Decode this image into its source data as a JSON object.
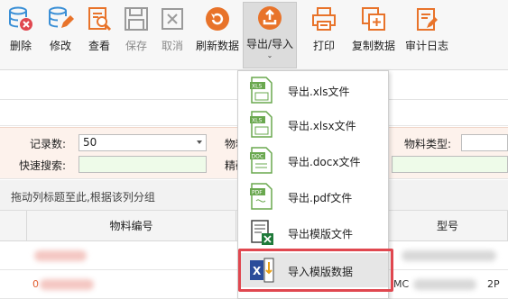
{
  "toolbar": {
    "buttons": [
      {
        "label": "删除",
        "icon": "delete-db-icon",
        "enabled": true
      },
      {
        "label": "修改",
        "icon": "edit-db-icon",
        "enabled": true
      },
      {
        "label": "查看",
        "icon": "view-icon",
        "enabled": true
      },
      {
        "label": "保存",
        "icon": "save-icon",
        "enabled": false
      },
      {
        "label": "取消",
        "icon": "cancel-icon",
        "enabled": false
      },
      {
        "label": "刷新数据",
        "icon": "refresh-icon",
        "enabled": true
      },
      {
        "label": "导出/导入",
        "icon": "export-import-icon",
        "enabled": true,
        "active": true
      },
      {
        "label": "打印",
        "icon": "print-icon",
        "enabled": true
      },
      {
        "label": "复制数据",
        "icon": "copy-icon",
        "enabled": true
      },
      {
        "label": "审计日志",
        "icon": "audit-log-icon",
        "enabled": true
      }
    ],
    "caret": "⌄"
  },
  "filters": {
    "record_count_label": "记录数:",
    "record_count_value": "50",
    "material_label": "物料",
    "material_type_label": "物料类型:",
    "quick_search_label": "快速搜索:",
    "precise_label": "精确"
  },
  "grid": {
    "group_hint": "拖动列标题至此,根据该列分组",
    "columns": [
      "物料编号",
      "型号"
    ],
    "row_fragments": [
      "0",
      "MC",
      "2P"
    ]
  },
  "export_menu": {
    "items": [
      {
        "label": "导出.xls文件",
        "icon": "xls-file-icon",
        "tag": "XLS"
      },
      {
        "label": "导出.xlsx文件",
        "icon": "xlsx-file-icon",
        "tag": "XLS"
      },
      {
        "label": "导出.docx文件",
        "icon": "docx-file-icon",
        "tag": "DOC"
      },
      {
        "label": "导出.pdf文件",
        "icon": "pdf-file-icon",
        "tag": "PDF"
      },
      {
        "label": "导出模版文件",
        "icon": "template-export-icon",
        "tag": ""
      },
      {
        "label": "导入模版数据",
        "icon": "template-import-icon",
        "tag": "X"
      }
    ],
    "highlighted_index": 5
  },
  "colors": {
    "accent": "#e8732a",
    "blue": "#3a8fd6",
    "red": "#e0474f",
    "disabled": "#9a9a9a"
  }
}
